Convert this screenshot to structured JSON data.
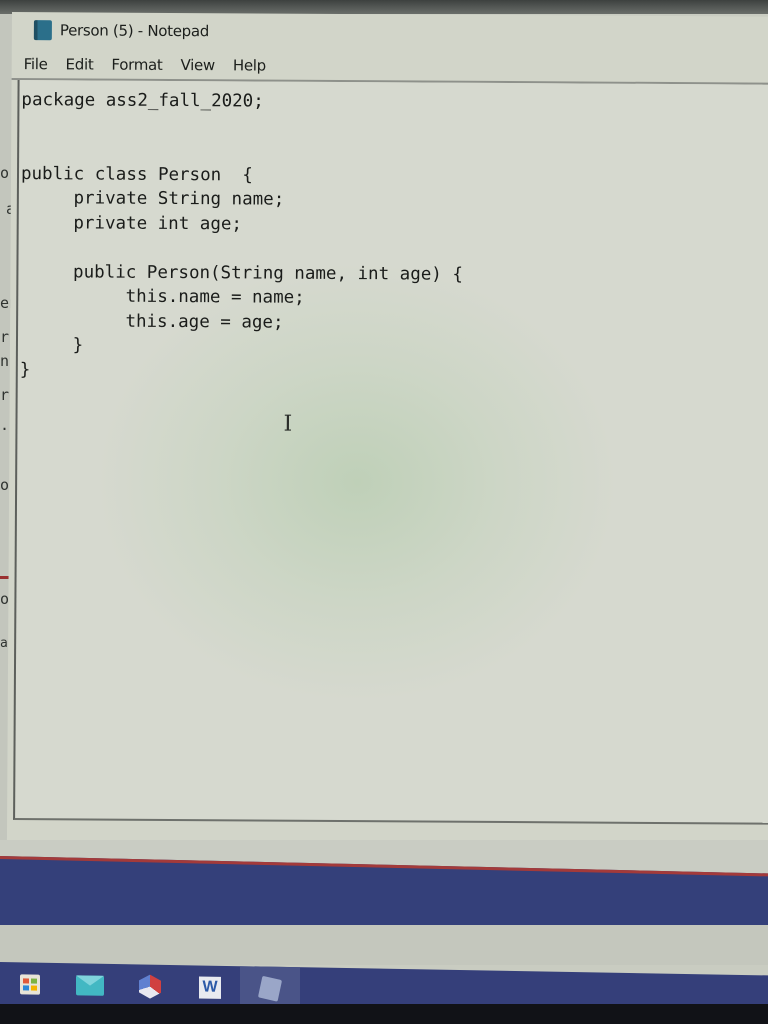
{
  "window": {
    "title": "Person (5) - Notepad",
    "app_icon": "notepad-icon"
  },
  "menubar": {
    "items": [
      {
        "label": "File"
      },
      {
        "label": "Edit"
      },
      {
        "label": "Format"
      },
      {
        "label": "View"
      },
      {
        "label": "Help"
      }
    ]
  },
  "editor": {
    "content": "package ass2_fall_2020;\n\n\npublic class Person  {\n     private String name;\n     private int age;\n\n     public Person(String name, int age) {\n          this.name = name;\n          this.age = age;\n     }\n}",
    "cursor_icon": "i-beam-cursor"
  },
  "background_window": {
    "fragments": [
      "o",
      "a",
      "en",
      "r-",
      "nt",
      "re",
      "..",
      "or",
      "on",
      "ati"
    ]
  },
  "taskbar": {
    "apps": [
      {
        "name": "Microsoft Store",
        "icon": "store-icon"
      },
      {
        "name": "Mail",
        "icon": "mail-icon"
      },
      {
        "name": "App",
        "icon": "hexagon-app-icon"
      },
      {
        "name": "Word",
        "icon": "word-icon",
        "glyph": "W"
      },
      {
        "name": "Notepad",
        "icon": "notepad-icon"
      }
    ]
  },
  "colors": {
    "taskbar": "#353f7a",
    "accent_red": "#a33a3a",
    "editor_bg": "#d6d9cf"
  }
}
